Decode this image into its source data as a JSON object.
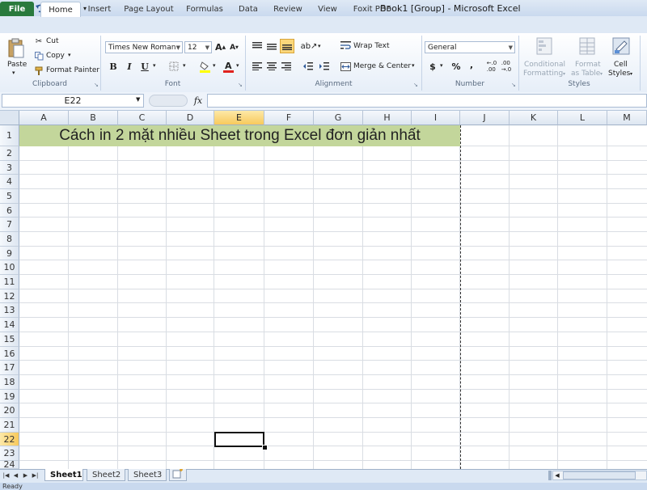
{
  "window": {
    "title": "Book1  [Group]  -  Microsoft Excel",
    "app_icon": "X",
    "qat": [
      "save-icon",
      "undo-icon",
      "redo-icon",
      "customize-icon"
    ]
  },
  "tabs": [
    "File",
    "Home",
    "Insert",
    "Page Layout",
    "Formulas",
    "Data",
    "Review",
    "View",
    "Foxit PDF"
  ],
  "active_tab": "Home",
  "ribbon": {
    "clipboard": {
      "label": "Clipboard",
      "paste": "Paste",
      "cut": "Cut",
      "copy": "Copy",
      "format_painter": "Format Painter"
    },
    "font": {
      "label": "Font",
      "name": "Times New Roman",
      "size": "12",
      "bold": "B",
      "italic": "I",
      "underline": "U"
    },
    "alignment": {
      "label": "Alignment",
      "wrap_text": "Wrap Text",
      "merge_center": "Merge & Center"
    },
    "number": {
      "label": "Number",
      "format": "General",
      "currency": "$",
      "percent": "%",
      "comma": ","
    },
    "styles": {
      "label": "Styles",
      "conditional_1": "Conditional",
      "conditional_2": "Formatting",
      "table_1": "Format",
      "table_2": "as Table",
      "cell_1": "Cell",
      "cell_2": "Styles"
    }
  },
  "formula_bar": {
    "name_box": "E22",
    "fx": "fx",
    "value": ""
  },
  "columns": [
    "A",
    "B",
    "C",
    "D",
    "E",
    "F",
    "G",
    "H",
    "I",
    "J",
    "K",
    "L",
    "M"
  ],
  "selected_column": "E",
  "rows": [
    "1",
    "2",
    "3",
    "4",
    "5",
    "6",
    "7",
    "8",
    "9",
    "10",
    "11",
    "12",
    "13",
    "14",
    "15",
    "16",
    "17",
    "18",
    "19",
    "20",
    "21",
    "22",
    "23",
    "24"
  ],
  "selected_row": "22",
  "cells": {
    "A1": "Cách in 2 mặt nhiều Sheet trong Excel đơn giản nhất"
  },
  "merged_fill_color": "#c3d69b",
  "sheet_tabs": [
    "Sheet1",
    "Sheet2",
    "Sheet3"
  ],
  "active_sheet": "Sheet1",
  "status": "Ready"
}
